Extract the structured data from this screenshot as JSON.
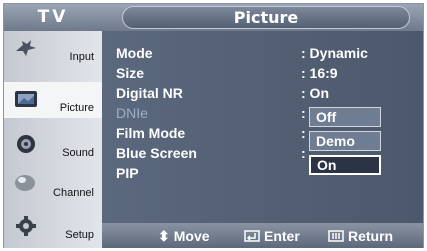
{
  "header": {
    "tv_label": "TV",
    "title": "Picture"
  },
  "sidebar": {
    "items": [
      {
        "label": "Input",
        "icon": "input-icon"
      },
      {
        "label": "Picture",
        "icon": "picture-icon",
        "active": true
      },
      {
        "label": "Sound",
        "icon": "sound-icon"
      },
      {
        "label": "Channel",
        "icon": "channel-icon"
      },
      {
        "label": "Setup",
        "icon": "setup-icon"
      }
    ]
  },
  "menu": {
    "rows": [
      {
        "label": "Mode",
        "value": ": Dynamic"
      },
      {
        "label": "Size",
        "value": ": 16:9"
      },
      {
        "label": "Digital NR",
        "value": ": On"
      },
      {
        "label": "DNIe",
        "value": ":"
      },
      {
        "label": "Film Mode",
        "value": ":"
      },
      {
        "label": "Blue Screen",
        "value": ":"
      },
      {
        "label": "PIP",
        "value": ""
      }
    ],
    "dnie_options": [
      "Off",
      "Demo",
      "On"
    ],
    "dnie_selected": "On"
  },
  "footer": {
    "move": "Move",
    "enter": "Enter",
    "return": "Return"
  }
}
